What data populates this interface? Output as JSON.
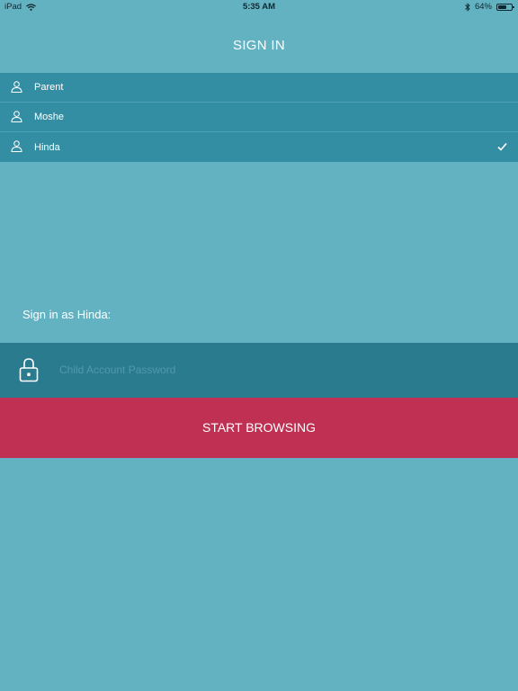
{
  "status_bar": {
    "device": "iPad",
    "time": "5:35 AM",
    "battery_percent": "64%",
    "battery_level": 0.64,
    "icons": [
      "wifi-icon",
      "bluetooth-icon",
      "battery-icon"
    ]
  },
  "header": {
    "title": "SIGN IN"
  },
  "accounts": [
    {
      "label": "Parent",
      "selected": false
    },
    {
      "label": "Moshe",
      "selected": false
    },
    {
      "label": "Hinda",
      "selected": true
    }
  ],
  "signin": {
    "prompt": "Sign in as Hinda:",
    "password_placeholder": "Child Account Password",
    "password_value": ""
  },
  "actions": {
    "start_label": "START BROWSING"
  },
  "colors": {
    "background": "#63b2c2",
    "list_background": "#348ea3",
    "password_row": "#2b7b8f",
    "start_button": "#c03053",
    "text": "#ffffff"
  }
}
